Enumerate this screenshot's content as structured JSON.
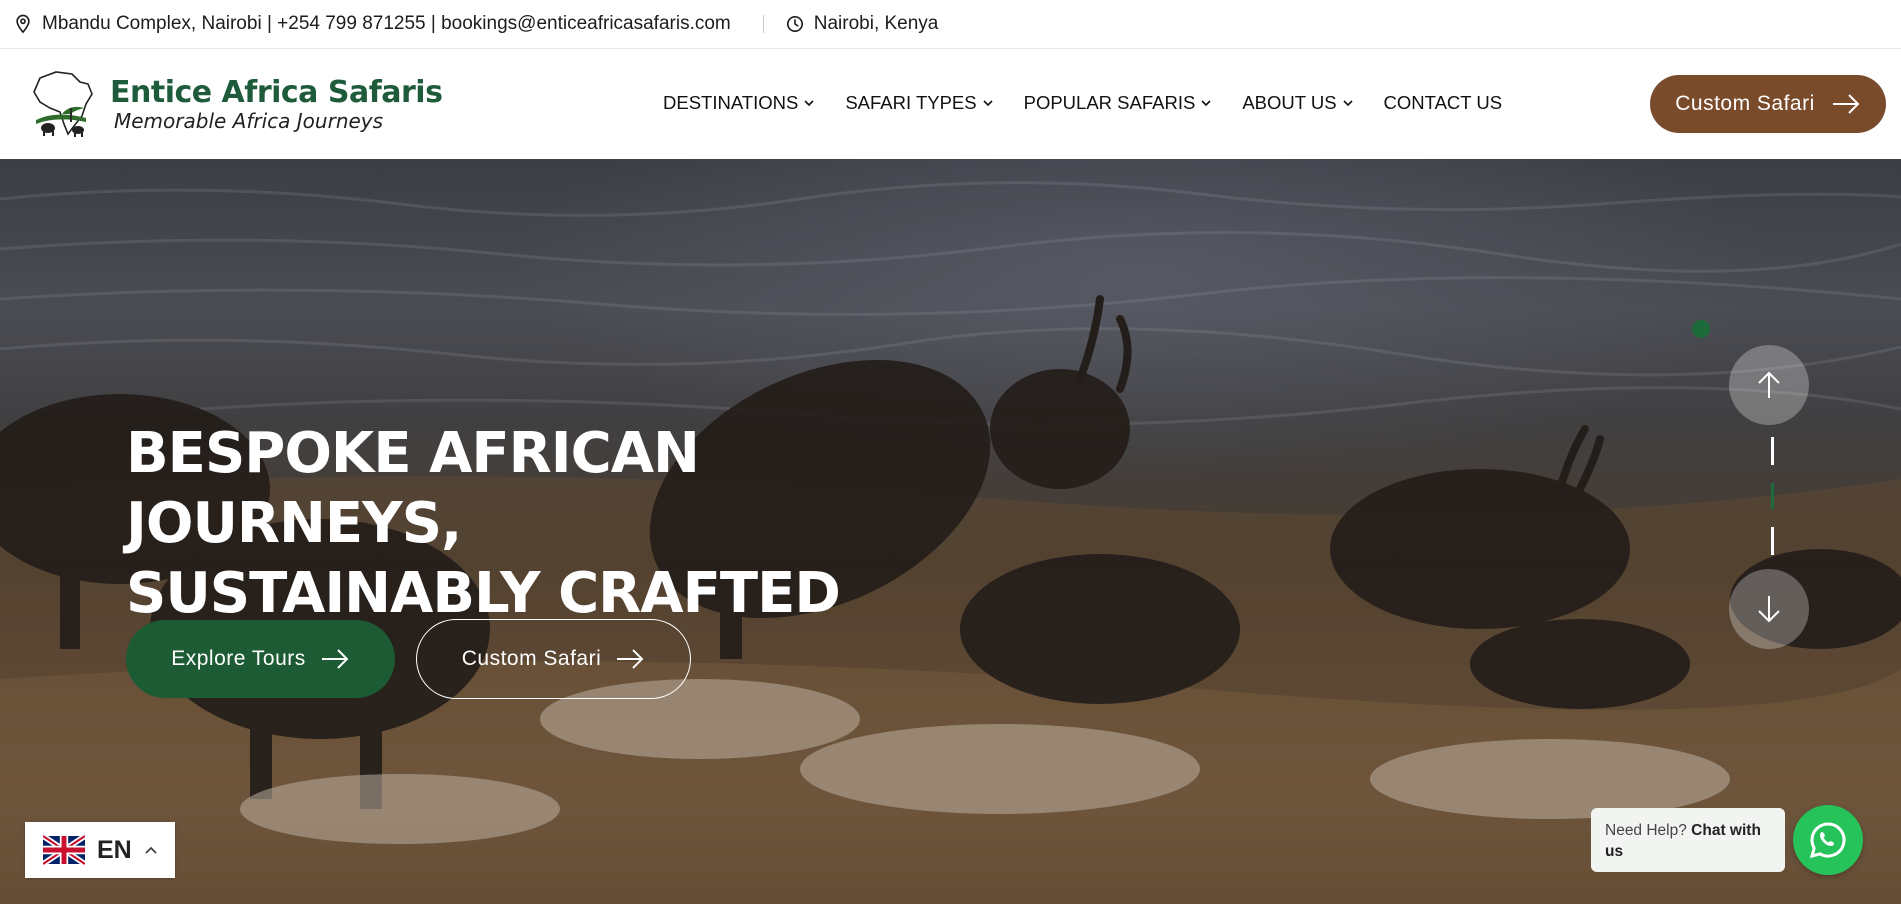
{
  "topbar": {
    "contact": "Mbandu Complex, Nairobi | +254 799 871255 | bookings@enticeafricasafaris.com",
    "location": "Nairobi, Kenya",
    "location_icon": "map-pin-icon",
    "clock_icon": "clock-icon"
  },
  "logo": {
    "title": "Entice Africa Safaris",
    "subtitle": "Memorable Africa Journeys"
  },
  "nav": {
    "items": [
      {
        "label": "DESTINATIONS",
        "has_dropdown": true
      },
      {
        "label": "SAFARI TYPES",
        "has_dropdown": true
      },
      {
        "label": "POPULAR SAFARIS",
        "has_dropdown": true
      },
      {
        "label": "ABOUT US",
        "has_dropdown": true
      },
      {
        "label": "CONTACT US",
        "has_dropdown": false
      }
    ],
    "cta_label": "Custom Safari"
  },
  "hero": {
    "title_line1": "BESPOKE AFRICAN JOURNEYS,",
    "title_line2": "SUSTAINABLY CRAFTED",
    "primary_button": "Explore Tours",
    "secondary_button": "Custom Safari"
  },
  "language": {
    "code": "EN"
  },
  "chat": {
    "prefix": "Need Help?",
    "bold": "Chat with us"
  },
  "colors": {
    "brand_green": "#1c5b34",
    "brand_brown": "#7a4b2a",
    "whatsapp": "#25c35a"
  }
}
